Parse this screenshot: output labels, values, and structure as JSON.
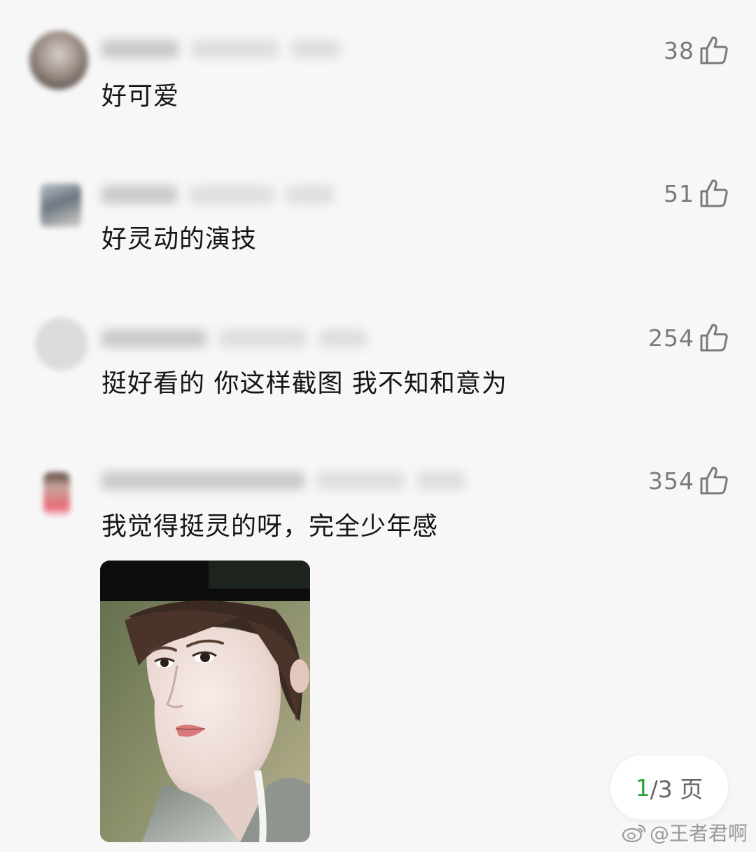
{
  "comments": [
    {
      "text": "好可爱",
      "likes": "38"
    },
    {
      "text": "好灵动的演技",
      "likes": "51"
    },
    {
      "text": "挺好看的 你这样截图 我不知和意为",
      "likes": "254"
    },
    {
      "text": "我觉得挺灵的呀，完全少年感",
      "likes": "354"
    }
  ],
  "pager": {
    "current": "1",
    "rest": "/3 页"
  },
  "watermark": {
    "text": "@王者君啊"
  },
  "icons": {
    "like": "thumbs-up-icon",
    "weibo": "weibo-logo-icon"
  },
  "colors": {
    "background": "#f7f7f7",
    "text": "#151515",
    "like": "#7a7a7a",
    "pager_current": "#2aa33a"
  }
}
